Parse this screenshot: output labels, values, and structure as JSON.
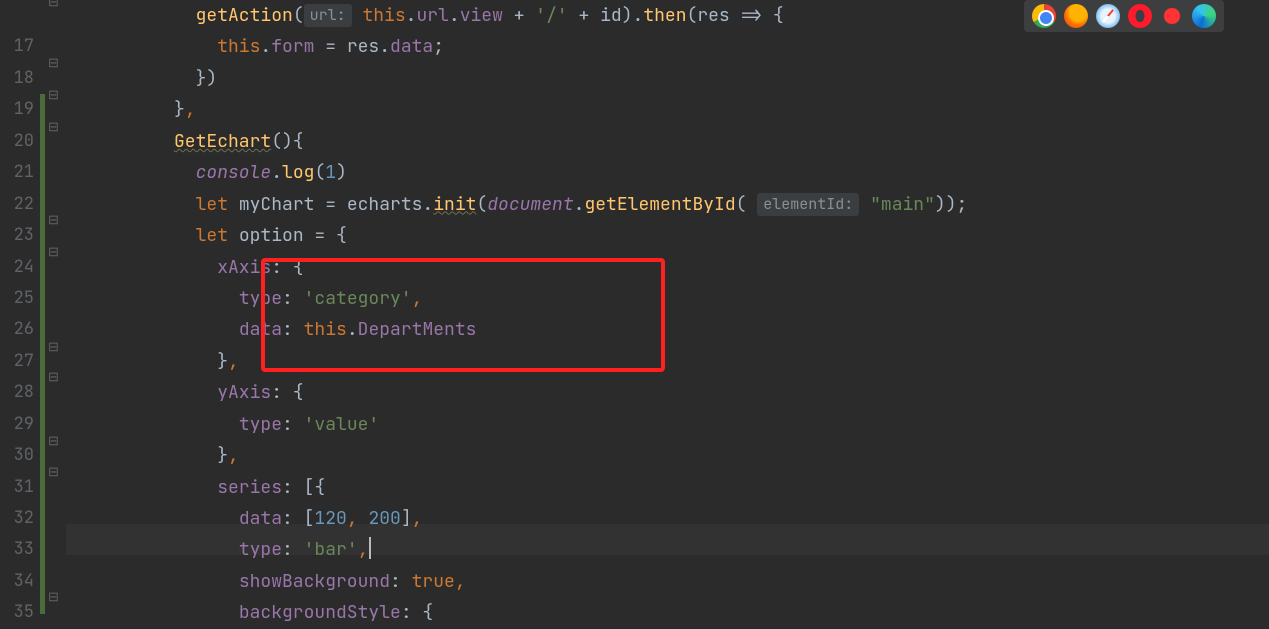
{
  "gutter": {
    "lines": [
      "",
      "17",
      "18",
      "19",
      "20",
      "21",
      "22",
      "23",
      "24",
      "25",
      "26",
      "27",
      "28",
      "29",
      "30",
      "31",
      "32",
      "33",
      "34",
      "35"
    ]
  },
  "hints": {
    "url": "url:",
    "elementId": "elementId:"
  },
  "code": {
    "l0_a": "getAction",
    "l0_b": " ",
    "l0_c": "this",
    "l0_d": ".",
    "l0_e": "url",
    "l0_f": ".",
    "l0_g": "view",
    "l0_h": " + ",
    "l0_i": "'/'",
    "l0_j": " + id).",
    "l0_k": "then",
    "l0_l": "(res => {",
    "l1_a": "this",
    "l1_b": ".",
    "l1_c": "form",
    "l1_d": " = res.",
    "l1_e": "data",
    "l1_f": ";",
    "l2": "})",
    "l3_a": "}",
    "l3_b": ",",
    "l4_a": "GetEchart",
    "l4_b": "(){",
    "l5_a": "console",
    "l5_b": ".",
    "l5_c": "log",
    "l5_d": "(",
    "l5_e": "1",
    "l5_f": ")",
    "l6_a": "let",
    "l6_b": " myChart = echarts.",
    "l6_c": "init",
    "l6_d": "(",
    "l6_e": "document",
    "l6_f": ".",
    "l6_g": "getElementById",
    "l6_h": "( ",
    "l6_i": " ",
    "l6_j": "\"main\"",
    "l6_k": "));",
    "l7_a": "let",
    "l7_b": " option = {",
    "l8_a": "xAxis",
    "l8_b": ": {",
    "l9_a": "type",
    "l9_b": ": ",
    "l9_c": "'category'",
    "l9_d": ",",
    "l10_a": "data",
    "l10_b": ": ",
    "l10_c": "this",
    "l10_d": ".",
    "l10_e": "DepartMents",
    "l11_a": "}",
    "l11_b": ",",
    "l12_a": "yAxis",
    "l12_b": ": {",
    "l13_a": "type",
    "l13_b": ": ",
    "l13_c": "'value'",
    "l14_a": "}",
    "l14_b": ",",
    "l15_a": "series",
    "l15_b": ": [{",
    "l16_a": "data",
    "l16_b": ": [",
    "l16_c": "120",
    "l16_d": ", ",
    "l16_e": "200",
    "l16_f": "]",
    "l16_g": ",",
    "l17_a": "type",
    "l17_b": ": ",
    "l17_c": "'bar'",
    "l17_d": ",",
    "l18_a": "showBackground",
    "l18_b": ": ",
    "l18_c": "true",
    "l18_d": ",",
    "l19_a": "backgroundStyle",
    "l19_b": ": {"
  }
}
